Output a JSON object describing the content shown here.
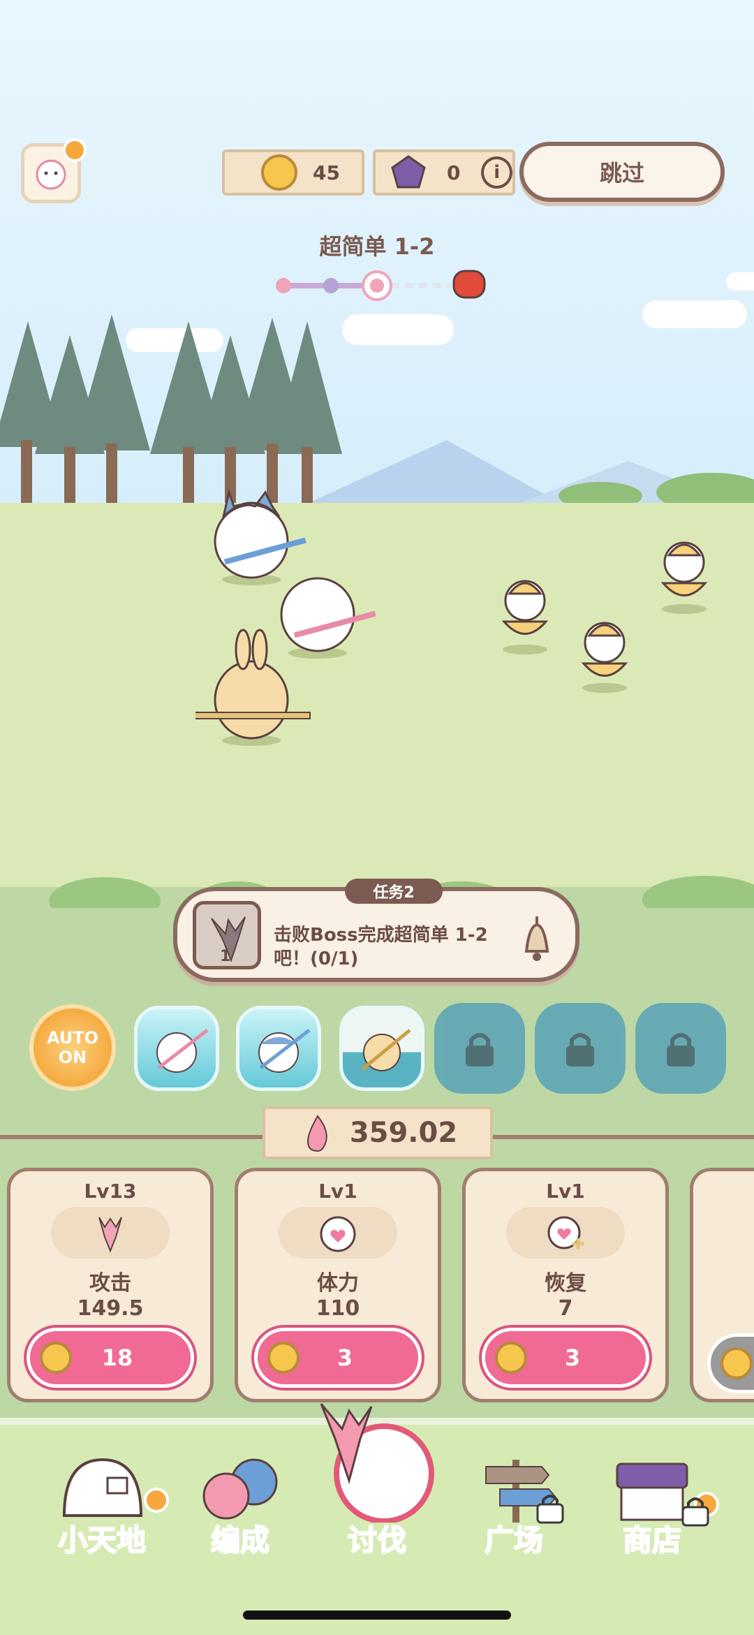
{
  "header": {
    "coins": "45",
    "gems": "0",
    "skip_label": "跳过",
    "stage_title": "超简单 1-2"
  },
  "task": {
    "badge": "任务2",
    "description": "击败Boss完成超简单 1-2吧！(0/1)",
    "weapon_count": "1"
  },
  "auto": {
    "line1": "AUTO",
    "line2": "ON"
  },
  "power": "359.02",
  "upgrades": [
    {
      "level": "Lv13",
      "name": "攻击",
      "value": "149.5",
      "cost": "18"
    },
    {
      "level": "Lv1",
      "name": "体力",
      "value": "110",
      "cost": "3"
    },
    {
      "level": "Lv1",
      "name": "恢复",
      "value": "7",
      "cost": "3"
    }
  ],
  "nav": [
    {
      "label": "小天地",
      "color": "#f0893a"
    },
    {
      "label": "编成",
      "color": "#5b8ad6"
    },
    {
      "label": "讨伐",
      "color": "#e25a78"
    },
    {
      "label": "广场",
      "color": "#6b5b5b"
    },
    {
      "label": "商店",
      "color": "#6b5aa8"
    }
  ]
}
